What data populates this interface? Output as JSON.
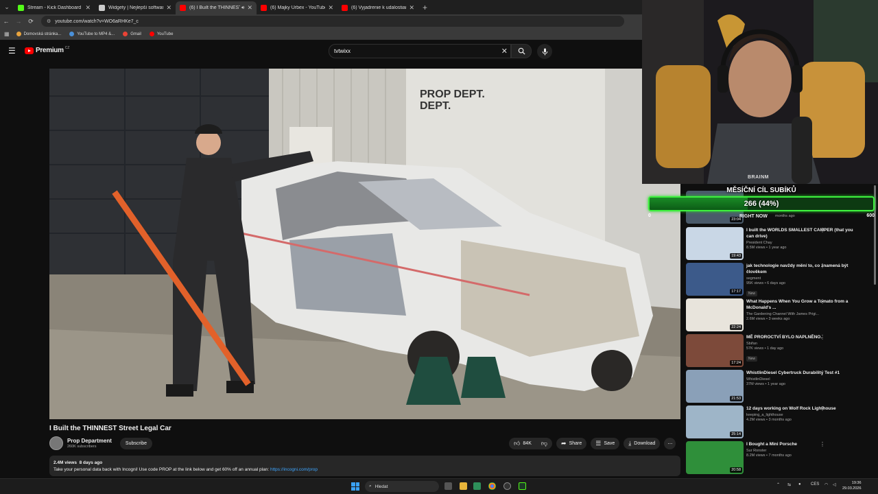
{
  "browser": {
    "tabs": [
      {
        "title": "Stream - Kick Dashboard",
        "favicon_color": "#53fc18",
        "active": false
      },
      {
        "title": "Widgety | Nejlepší software pro",
        "favicon_color": "#cccccc",
        "active": false
      },
      {
        "title": "(6) I Built the THINNEST Str",
        "favicon_color": "#ff0000",
        "active": true,
        "audio": true
      },
      {
        "title": "(6) Majky Urbex - YouTube",
        "favicon_color": "#ff0000",
        "active": false
      },
      {
        "title": "(6) Vyjadrenie k udalostiam v D",
        "favicon_color": "#ff0000",
        "active": false
      }
    ],
    "url": "youtube.com/watch?v=WO6aRHKe7_c",
    "bookmarks": [
      {
        "label": "Domovská stránka...",
        "color": "#e7a33e"
      },
      {
        "label": "YouTube to MP4 &...",
        "color": "#4a90d9"
      },
      {
        "label": "Gmail",
        "color": "#ea4335"
      },
      {
        "label": "YouTube",
        "color": "#ff0000"
      }
    ]
  },
  "youtube": {
    "logo_text": "Premium",
    "logo_country": "CZ",
    "search_value": "tvtwixx",
    "video": {
      "title": "I Built the THINNEST Street Legal Car",
      "channel": "Prop Department",
      "subscribers": "260K subscribers",
      "subscribe_label": "Subscribe",
      "likes": "84K",
      "share_label": "Share",
      "save_label": "Save",
      "download_label": "Download",
      "views": "2.4M views",
      "age": "8 days ago",
      "description": "Take your personal data back with Incogni! Use code PROP at the link below and get 60% off an annual plan:",
      "description_link": "https://incogni.com/prop",
      "sign_text": "PROP DEPT."
    },
    "right_now_label": "RIGHT NOW",
    "right_now_meta": "months ago",
    "recommendations": [
      {
        "title": "I built the WORLDS SMALLEST CAMPER (that you can drive)",
        "channel": "President Chay",
        "views": "8.5M views",
        "age": "1 year ago",
        "duration": "19:43",
        "badge": "",
        "thumb": "#c9d7e6"
      },
      {
        "title": "jak technologie navždy mění to, co znamená být člověkem",
        "channel": "segment",
        "views": "95K views",
        "age": "6 days ago",
        "duration": "17:17",
        "badge": "New",
        "thumb": "#3c5a8a"
      },
      {
        "title": "What Happens When You Grow a Tomato from a McDonald's ...",
        "channel": "The Gardening Channel With James Prigi...",
        "views": "2.6M views",
        "age": "3 weeks ago",
        "duration": "22:24",
        "badge": "",
        "thumb": "#e8e4dc"
      },
      {
        "title": "MĚ PROROCTVÍ BYLO NAPLNĚNO.",
        "channel": "Sbiřan",
        "views": "57K views",
        "age": "1 day ago",
        "duration": "17:24",
        "badge": "New",
        "thumb": "#7d4a3a"
      },
      {
        "title": "WhistlinDiesel Cybertruck Durability Test #1",
        "channel": "WhistlinDiesel",
        "views": "37M views",
        "age": "1 year ago",
        "duration": "21:53",
        "badge": "",
        "thumb": "#8aa0b8"
      },
      {
        "title": "12 days working on Wolf Rock Lighthouse",
        "channel": "keeping_a_lighthouse",
        "views": "4.2M views",
        "age": "3 months ago",
        "duration": "25:14",
        "badge": "",
        "thumb": "#9eb5c8"
      },
      {
        "title": "I Bought a Mini Porsche",
        "channel": "Sur Ronster",
        "views": "8.2M views",
        "age": "7 months ago",
        "duration": "20:58",
        "badge": "",
        "thumb": "#2f8f3a"
      }
    ]
  },
  "overlay": {
    "goal_title": "MĚSÍČNÍ CÍL SUBÍKŮ",
    "goal_value_text": "266 (44%)",
    "goal_fraction": 0.44,
    "goal_min": "0",
    "goal_max": "600",
    "mic_brand": "BRAINM"
  },
  "taskbar": {
    "search_placeholder": "Hledat",
    "lang": "CES",
    "time": "19:36",
    "date": "29.03.2026"
  }
}
